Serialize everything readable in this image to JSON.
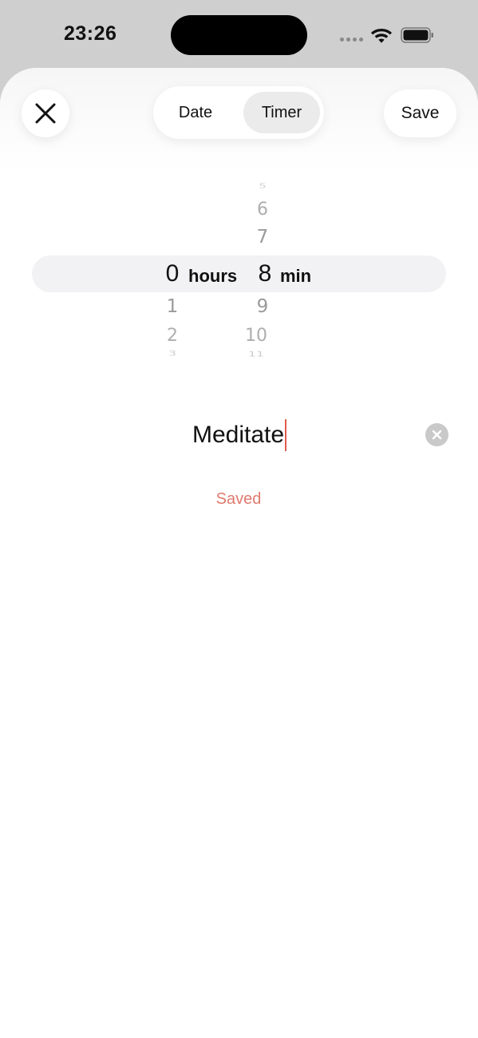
{
  "status_bar": {
    "time": "23:26",
    "icons": [
      "signal-dots-icon",
      "wifi-icon",
      "battery-icon"
    ]
  },
  "header": {
    "close_icon": "close-icon",
    "tabs": [
      {
        "label": "Date",
        "selected": false
      },
      {
        "label": "Timer",
        "selected": true
      }
    ],
    "save_label": "Save"
  },
  "picker": {
    "hours": {
      "above": [
        "",
        "",
        ""
      ],
      "selected": "0",
      "below": [
        "1",
        "2",
        "3"
      ],
      "unit": "hours"
    },
    "minutes": {
      "above": [
        "5",
        "6",
        "7"
      ],
      "selected": "8",
      "below": [
        "9",
        "10",
        "11"
      ],
      "unit": "min"
    }
  },
  "title_field": {
    "value": "Meditate",
    "clear_icon": "clear-icon"
  },
  "status": {
    "text": "Saved",
    "color": "#e07a6f"
  },
  "colors": {
    "accent": "#e05b4f",
    "selected_tab_bg": "#ebebeb",
    "picker_highlight": "#f2f2f4"
  }
}
